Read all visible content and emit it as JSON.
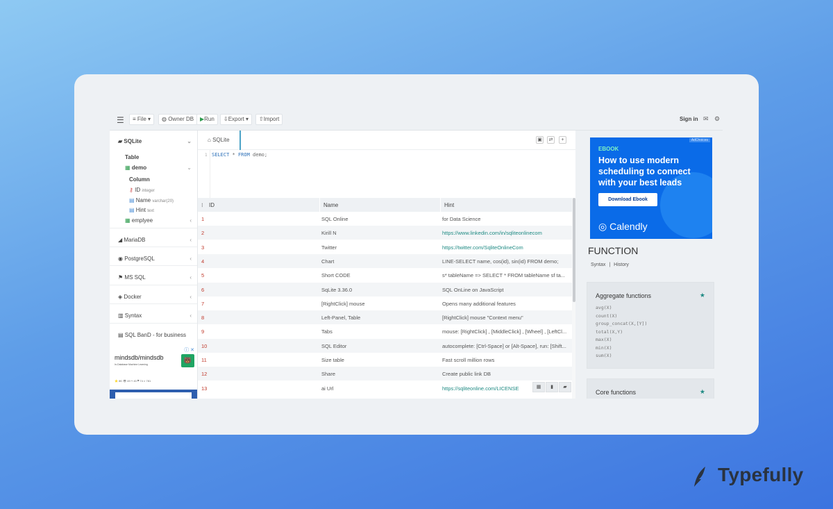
{
  "toolbar": {
    "menu_icon": "hamburger-icon",
    "file": "File",
    "owner_db": "Owner DB",
    "run": "Run",
    "export": "Export",
    "import": "Import",
    "sign_in": "Sign in"
  },
  "sidebar": {
    "sqlite": "SQLite",
    "table": "Table",
    "demo": "demo",
    "column": "Column",
    "columns": [
      {
        "name": "ID",
        "type": "integer"
      },
      {
        "name": "Name",
        "type": "varchar(20)"
      },
      {
        "name": "Hint",
        "type": "text"
      }
    ],
    "emplyee": "emplyee",
    "dbs": [
      "MariaDB",
      "PostgreSQL",
      "MS SQL",
      "Docker",
      "Syntax",
      "SQL BanD - for business"
    ]
  },
  "ad": {
    "logo": "mindsdb/mindsdb",
    "subtitle": "In-Database Machine Learning",
    "stats": "⭐ 8K   👁 49   ⑂ 40   ⚑ 74   ☆ 781"
  },
  "editor": {
    "tab": "SQLite",
    "line": "1",
    "code_kw1": "SELECT",
    "code_mid": " * ",
    "code_kw2": "FROM",
    "code_tail": " demo;"
  },
  "grid": {
    "headers": [
      "ID",
      "Name",
      "Hint"
    ],
    "rows": [
      {
        "id": "1",
        "name": "SQL Online",
        "hint": "for Data Science",
        "link": false
      },
      {
        "id": "2",
        "name": "Kirill N",
        "hint": "https://www.linkedin.com/in/sqliteonlinecom",
        "link": true
      },
      {
        "id": "3",
        "name": "Twitter",
        "hint": "https://twitter.com/SqliteOnlineCom",
        "link": true
      },
      {
        "id": "4",
        "name": "Chart",
        "hint": "LINE-SELECT name, cos(id), sin(id) FROM demo;",
        "link": false
      },
      {
        "id": "5",
        "name": "Short CODE",
        "hint": "s* tableName => SELECT * FROM tableName sf ta...",
        "link": false
      },
      {
        "id": "6",
        "name": "SqLite 3.36.0",
        "hint": "SQL OnLine on JavaScript",
        "link": false
      },
      {
        "id": "7",
        "name": "[RightClick] mouse",
        "hint": "Opens many additional features",
        "link": false
      },
      {
        "id": "8",
        "name": "Left-Panel, Table",
        "hint": "[RightClick] mouse \"Context menu\"",
        "link": false
      },
      {
        "id": "9",
        "name": "Tabs",
        "hint": "mouse: [RightClick] , [MiddleClick] , [Wheel] , [LeftCl...",
        "link": false
      },
      {
        "id": "10",
        "name": "SQL Editor",
        "hint": "autocomplete: [Ctrl-Space] or [Alt-Space], run: [Shift...",
        "link": false
      },
      {
        "id": "11",
        "name": "Size table",
        "hint": "Fast scroll million rows",
        "link": false
      },
      {
        "id": "12",
        "name": "Share",
        "hint": "Create public link DB",
        "link": false
      },
      {
        "id": "13",
        "name": "ai Url",
        "hint": "https://sqliteonline.com/LICENSE",
        "link": true
      }
    ]
  },
  "promo": {
    "tag": "AdChoices",
    "kicker": "EBOOK",
    "title": "How to use modern scheduling to connect with your best leads",
    "button": "Download Ebook",
    "logo": "Calendly"
  },
  "functions": {
    "title": "FUNCTION",
    "tab_syntax": "Syntax",
    "tab_sep": "|",
    "tab_history": "History",
    "aggregate_title": "Aggregate functions",
    "aggregate": [
      "avg(X)",
      "count(X)",
      "group_concat(X,[Y])",
      "total(X,Y)",
      "max(X)",
      "min(X)",
      "sum(X)"
    ],
    "core_title": "Core functions"
  },
  "brand": {
    "name": "Typefully"
  },
  "colors": {
    "accent": "#1e8a83",
    "id_red": "#c0392b",
    "promo_blue": "#0a6be8"
  }
}
